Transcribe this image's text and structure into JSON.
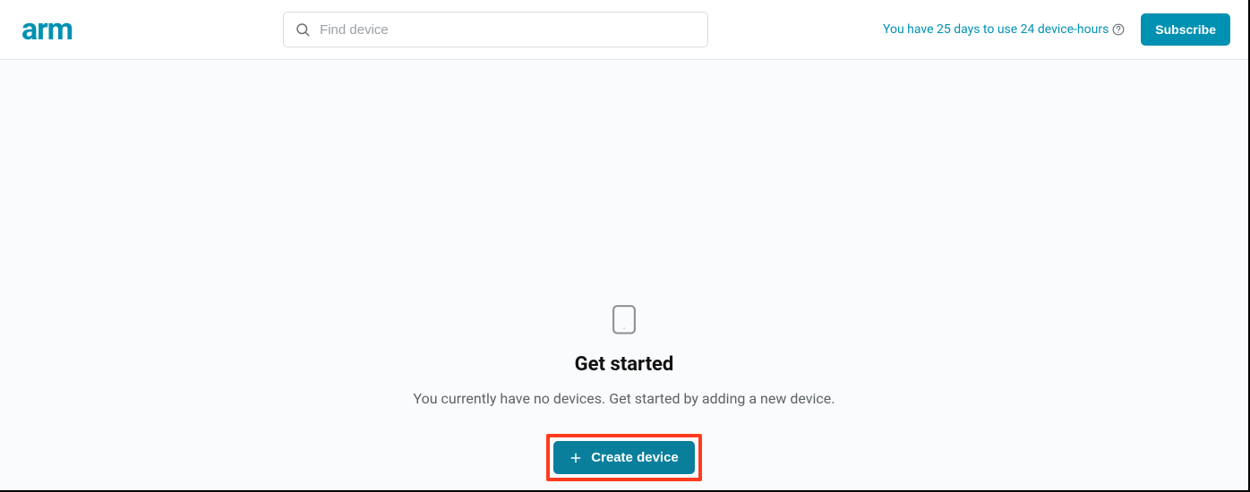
{
  "header": {
    "logo_text": "arm",
    "search_placeholder": "Find device",
    "trial_text": "You have 25 days to use 24 device-hours",
    "subscribe_label": "Subscribe"
  },
  "main": {
    "title": "Get started",
    "subtitle": "You currently have no devices. Get started by adding a new device.",
    "create_button_label": "Create device"
  }
}
